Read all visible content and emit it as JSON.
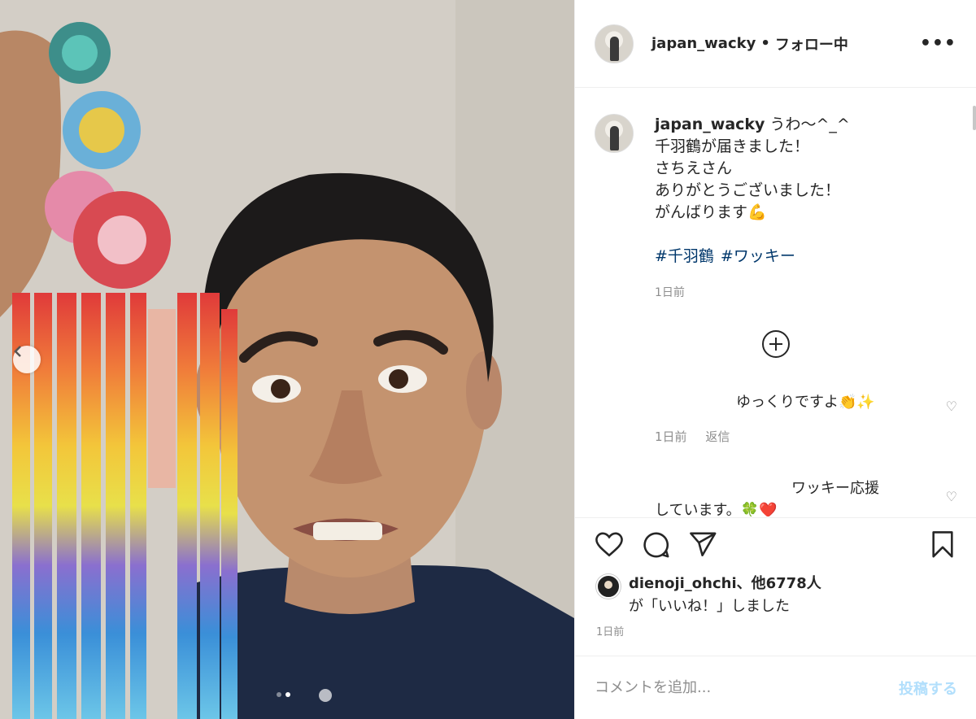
{
  "post": {
    "username": "japan_wacky",
    "separator": "•",
    "follow_status": "フォロー中",
    "more_icon": "more-horizontal-icon"
  },
  "caption": {
    "username": "japan_wacky",
    "lines": [
      "うわ〜^_^",
      "千羽鶴が届きました！",
      "さちえさん",
      "ありがとうございました！",
      "がんばります💪"
    ],
    "hashtags": [
      "#千羽鶴",
      "#ワッキー"
    ],
    "time": "1日前"
  },
  "replies": [
    {
      "text": "ゆっくりですよ👏✨",
      "time": "1日前",
      "reply_label": "返信"
    },
    {
      "text": "ワッキー応援",
      "text2": "しています。🍀❤️"
    }
  ],
  "actions": {
    "like_icon": "heart-icon",
    "comment_icon": "comment-icon",
    "share_icon": "send-icon",
    "save_icon": "bookmark-icon"
  },
  "likes": {
    "user": "dienoji_ohchi",
    "others": "、他6778人",
    "suffix": "が「いいね！」しました"
  },
  "post_time": "1日前",
  "comment_box": {
    "placeholder": "コメントを追加...",
    "post_label": "投稿する"
  },
  "carousel": {
    "slide_count": 2,
    "active_index": 1
  }
}
